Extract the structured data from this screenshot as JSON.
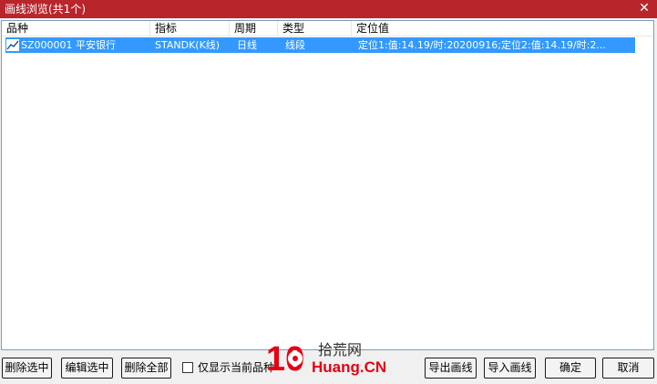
{
  "window": {
    "title": "画线浏览(共1个)",
    "close_glyph": "✕"
  },
  "list": {
    "columns": [
      "品种",
      "指标",
      "周期",
      "类型",
      "定位值"
    ],
    "rows": [
      {
        "symbol": "SZ000001 平安银行",
        "indicator": "STANDK(K线)",
        "period": "日线",
        "type": "线段",
        "position": "定位1:值:14.19/时:20200916;定位2:值:14.19/时:2..."
      }
    ],
    "selected_row_color": "#3399ff"
  },
  "buttons": {
    "delete_selected": "删除选中",
    "edit_selected": "编辑选中",
    "delete_all": "删除全部",
    "export": "导出画线",
    "import": "导入画线",
    "ok": "确定",
    "cancel": "取消"
  },
  "checkbox": {
    "label": "仅显示当前品种",
    "checked": false
  },
  "watermark": {
    "number": "10",
    "text_cn": "拾荒网",
    "text_en": "Huang.CN"
  },
  "colors": {
    "titlebar": "#b8262c",
    "watermark_red": "#e60012"
  }
}
